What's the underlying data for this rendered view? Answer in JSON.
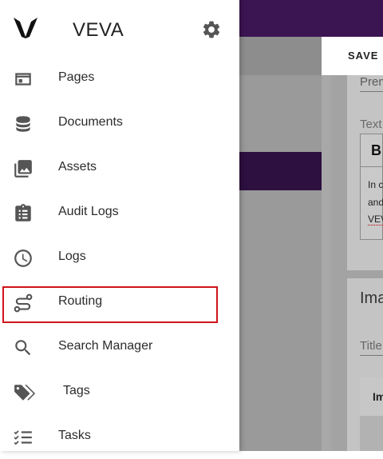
{
  "app": {
    "title": "VEVA"
  },
  "toolbar": {
    "save_label": "SAVE"
  },
  "nav": {
    "items": [
      {
        "label": "Pages",
        "icon": "pages-icon"
      },
      {
        "label": "Documents",
        "icon": "database-icon"
      },
      {
        "label": "Assets",
        "icon": "image-library-icon"
      },
      {
        "label": "Audit Logs",
        "icon": "clipboard-list-icon"
      },
      {
        "label": "Logs",
        "icon": "clock-icon"
      },
      {
        "label": "Routing",
        "icon": "route-icon"
      },
      {
        "label": "Search Manager",
        "icon": "search-icon"
      },
      {
        "label": "Tags",
        "icon": "tags-icon"
      },
      {
        "label": "Tasks",
        "icon": "checklist-icon"
      }
    ]
  },
  "background": {
    "field_value": "Prem",
    "text_label": "Text",
    "bold_button": "B",
    "editor_lines": [
      "In c",
      "and",
      "VEV"
    ],
    "card_title": "Ima",
    "title_field": "Title",
    "table_header": "Im"
  },
  "colors": {
    "brand": "#3b1452",
    "highlight": "#d0141b"
  }
}
